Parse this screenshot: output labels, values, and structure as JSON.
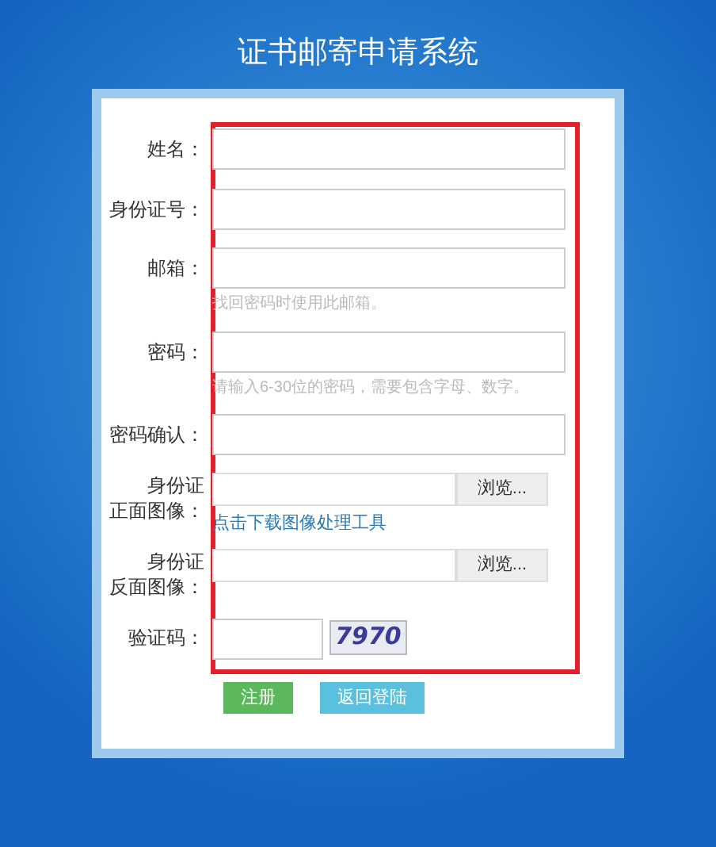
{
  "title": "证书邮寄申请系统",
  "fields": [
    {
      "kind": "text",
      "label": [
        "姓名："
      ]
    },
    {
      "kind": "text",
      "label": [
        "身份证号："
      ]
    },
    {
      "kind": "text",
      "label": [
        "邮箱："
      ],
      "hint": "找回密码时使用此邮箱。"
    },
    {
      "kind": "text",
      "label": [
        "密码："
      ],
      "hint": "请输入6-30位的密码，需要包含字母、数字。"
    },
    {
      "kind": "text",
      "label": [
        "密码确认："
      ]
    },
    {
      "kind": "file",
      "label": [
        "身份证",
        "正面图像："
      ],
      "button": "浏览...",
      "link": "点击下载图像处理工具"
    },
    {
      "kind": "file",
      "label": [
        "身份证",
        "反面图像："
      ],
      "button": "浏览..."
    },
    {
      "kind": "captcha",
      "label": [
        "验证码："
      ],
      "code": "7970"
    }
  ],
  "buttons": [
    {
      "label": "注册",
      "kind": "primary"
    },
    {
      "label": "返回登陆",
      "kind": "secondary"
    }
  ]
}
